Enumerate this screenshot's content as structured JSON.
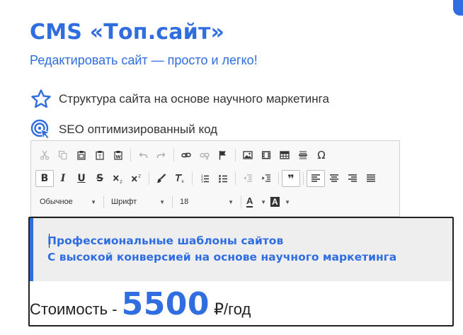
{
  "header": {
    "title": "CMS «Топ.сайт»",
    "subtitle": "Редактировать сайт — просто и легко!"
  },
  "features": [
    {
      "icon": "star-outline-icon",
      "text": "Структура сайта на основе научного маркетинга"
    },
    {
      "icon": "target-cursor-icon",
      "text": "SEO оптимизированный код"
    }
  ],
  "toolbar": {
    "format_select": "Обычное",
    "font_select": "Шрифт",
    "size_select": "18",
    "text_color_glyph": "A",
    "bg_color_glyph": "A",
    "bold_glyph": "B",
    "italic_glyph": "I",
    "underline_glyph": "U",
    "strike_glyph": "S",
    "special_char_glyph": "Ω",
    "quote_glyph": "❞"
  },
  "content": {
    "headline_line1": "Профессиональные шаблоны сайтов",
    "headline_line2": "С высокой конверсией на основе научного маркетинга",
    "price_label": "Стоимость -",
    "price_value": "5500",
    "price_unit": "₽/год"
  },
  "colors": {
    "accent": "#2f6de1",
    "toolbar_bg": "#f8f8f8",
    "quote_bg": "#eeeeee"
  }
}
